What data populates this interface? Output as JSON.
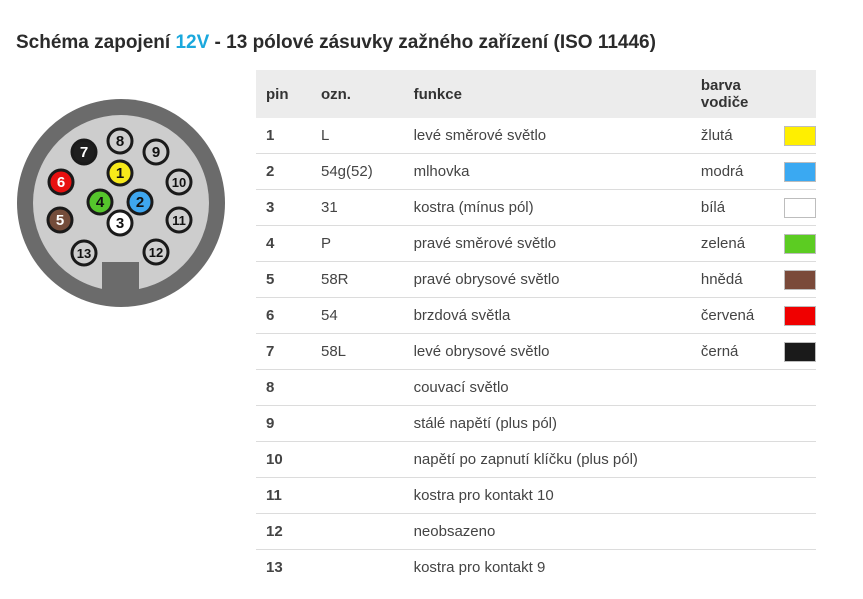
{
  "title": {
    "prefix": "Schéma zapojení ",
    "voltage": "12V",
    "suffix": " - 13 pólové zásuvky zažného zařízení (ISO 11446)",
    "accent_color": "#1aa8dd"
  },
  "connector": {
    "pins": [
      {
        "label": "1",
        "fill": "#f7e91a",
        "text": "#111111"
      },
      {
        "label": "2",
        "fill": "#3ea6ef",
        "text": "#111111"
      },
      {
        "label": "3",
        "fill": "#ffffff",
        "text": "#111111"
      },
      {
        "label": "4",
        "fill": "#55c52c",
        "text": "#111111"
      },
      {
        "label": "5",
        "fill": "#744c3a",
        "text": "#ffffff"
      },
      {
        "label": "6",
        "fill": "#e81010",
        "text": "#ffffff"
      },
      {
        "label": "7",
        "fill": "#1e1e1e",
        "text": "#ffffff"
      },
      {
        "label": "8",
        "fill": "#cfcfcf",
        "text": "#111111"
      },
      {
        "label": "9",
        "fill": "#cfcfcf",
        "text": "#111111"
      },
      {
        "label": "10",
        "fill": "#cfcfcf",
        "text": "#111111"
      },
      {
        "label": "11",
        "fill": "#cfcfcf",
        "text": "#111111"
      },
      {
        "label": "12",
        "fill": "#cfcfcf",
        "text": "#111111"
      },
      {
        "label": "13",
        "fill": "#cfcfcf",
        "text": "#111111"
      }
    ]
  },
  "table": {
    "headers": {
      "pin": "pin",
      "ozn": "ozn.",
      "funkce": "funkce",
      "barva": "barva vodiče"
    },
    "rows": [
      {
        "pin": "1",
        "ozn": "L",
        "funkce": "levé směrové světlo",
        "barva": "žlutá",
        "color": "#ffef00"
      },
      {
        "pin": "2",
        "ozn": "54g(52)",
        "funkce": "mlhovka",
        "barva": "modrá",
        "color": "#3aa9f2"
      },
      {
        "pin": "3",
        "ozn": "31",
        "funkce": "kostra (mínus pól)",
        "barva": "bílá",
        "color": "#ffffff"
      },
      {
        "pin": "4",
        "ozn": "P",
        "funkce": "pravé směrové světlo",
        "barva": "zelená",
        "color": "#5ccc22"
      },
      {
        "pin": "5",
        "ozn": "58R",
        "funkce": "pravé obrysové světlo",
        "barva": "hnědá",
        "color": "#7a4a3a"
      },
      {
        "pin": "6",
        "ozn": "54",
        "funkce": "brzdová světla",
        "barva": "červená",
        "color": "#f00000"
      },
      {
        "pin": "7",
        "ozn": "58L",
        "funkce": "levé obrysové světlo",
        "barva": "černá",
        "color": "#1a1a1a"
      },
      {
        "pin": "8",
        "ozn": "",
        "funkce": "couvací světlo",
        "barva": "",
        "color": ""
      },
      {
        "pin": "9",
        "ozn": "",
        "funkce": "stálé napětí (plus pól)",
        "barva": "",
        "color": ""
      },
      {
        "pin": "10",
        "ozn": "",
        "funkce": "napětí po zapnutí klíčku (plus pól)",
        "barva": "",
        "color": ""
      },
      {
        "pin": "11",
        "ozn": "",
        "funkce": "kostra pro kontakt 10",
        "barva": "",
        "color": ""
      },
      {
        "pin": "12",
        "ozn": "",
        "funkce": "neobsazeno",
        "barva": "",
        "color": ""
      },
      {
        "pin": "13",
        "ozn": "",
        "funkce": "kostra pro kontakt 9",
        "barva": "",
        "color": ""
      }
    ]
  }
}
